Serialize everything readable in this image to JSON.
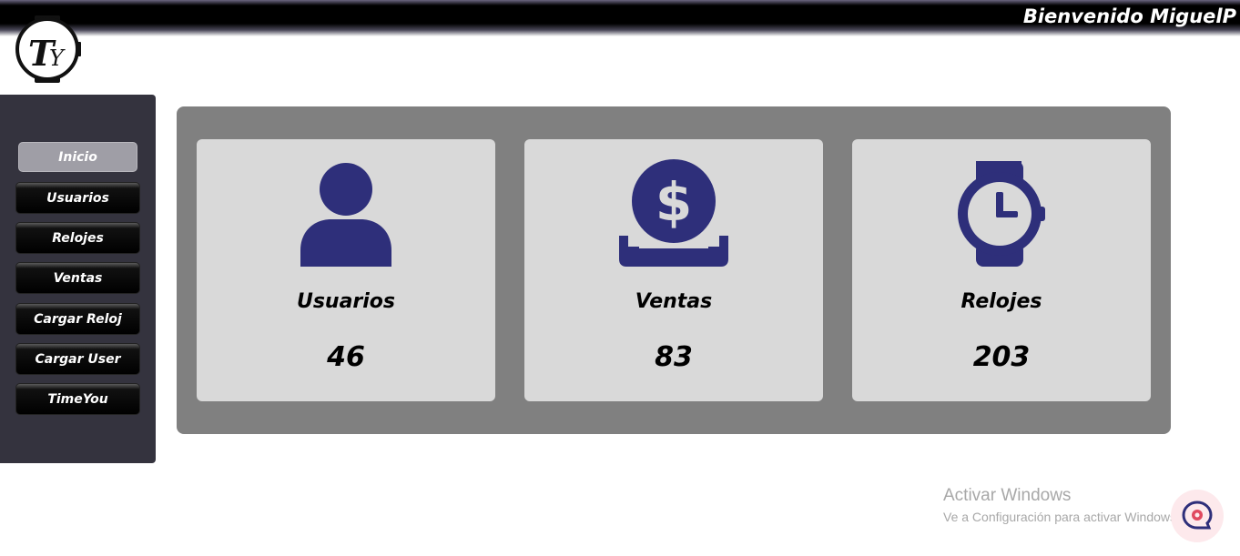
{
  "header": {
    "welcome": "Bienvenido MiguelP"
  },
  "logo": {
    "text": "TY"
  },
  "sidebar": {
    "items": [
      {
        "label": "Inicio",
        "active": true
      },
      {
        "label": "Usuarios"
      },
      {
        "label": "Relojes"
      },
      {
        "label": "Ventas"
      },
      {
        "label": "Cargar Reloj"
      },
      {
        "label": "Cargar User"
      },
      {
        "label": "TimeYou"
      }
    ]
  },
  "cards": [
    {
      "label": "Usuarios",
      "count": "46",
      "icon": "user-icon"
    },
    {
      "label": "Ventas",
      "count": "83",
      "icon": "dollar-coin-icon"
    },
    {
      "label": "Relojes",
      "count": "203",
      "icon": "watch-icon"
    }
  ],
  "watermark": {
    "title": "Activar Windows",
    "subtitle": "Ve a Configuración para activar Windows."
  },
  "colors": {
    "icon": "#2e2f7a",
    "sidebar": "#34333e",
    "panel": "#808080",
    "card": "#d9d9d9"
  }
}
